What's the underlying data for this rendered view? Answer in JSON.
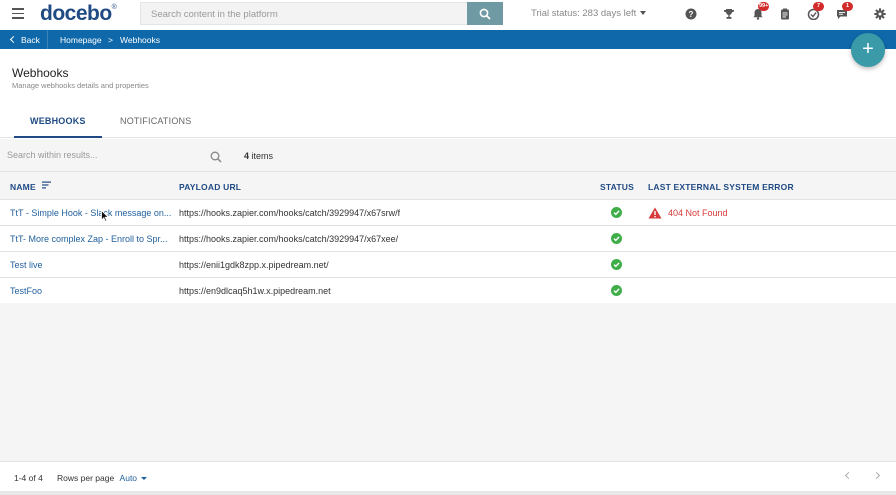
{
  "header": {
    "logo": "docebo",
    "search_placeholder": "Search content in the platform",
    "trial_label": "Trial status:",
    "trial_days": "283 days left",
    "notifications_badge": "99+",
    "courses_badge": "7",
    "messages_badge": "1"
  },
  "breadcrumb": {
    "back_label": "Back",
    "home": "Homepage",
    "separator": ">",
    "current": "Webhooks"
  },
  "page": {
    "title": "Webhooks",
    "subtitle": "Manage webhooks details and properties",
    "add_label": "+"
  },
  "tabs": [
    {
      "label": "WEBHOOKS",
      "active": true
    },
    {
      "label": "NOTIFICATIONS",
      "active": false
    }
  ],
  "filter": {
    "placeholder": "Search within results...",
    "count": "4",
    "count_suffix": "items"
  },
  "table": {
    "columns": [
      "NAME",
      "PAYLOAD URL",
      "STATUS",
      "LAST EXTERNAL SYSTEM ERROR"
    ],
    "rows": [
      {
        "name": "TtT - Simple Hook - Slack message on...",
        "url": "https://hooks.zapier.com/hooks/catch/3929947/x67srw/f",
        "status": "ok",
        "error": "404 Not Found"
      },
      {
        "name": "TtT- More complex Zap - Enroll to Spr...",
        "url": "https://hooks.zapier.com/hooks/catch/3929947/x67xee/",
        "status": "ok",
        "error": ""
      },
      {
        "name": "Test live",
        "url": "https://enii1gdk8zpp.x.pipedream.net/",
        "status": "ok",
        "error": ""
      },
      {
        "name": "TestFoo",
        "url": "https://en9dlcaq5h1w.x.pipedream.net",
        "status": "ok",
        "error": ""
      }
    ]
  },
  "footer": {
    "range": "1-4 of 4",
    "rows_per_page_label": "Rows per page",
    "rows_per_page_value": "Auto"
  },
  "colors": {
    "brand": "#1f4a84",
    "crumb_bar": "#0f68a9",
    "fab": "#3a9aa7",
    "status_ok": "#3fae49",
    "error": "#d73a3a"
  }
}
